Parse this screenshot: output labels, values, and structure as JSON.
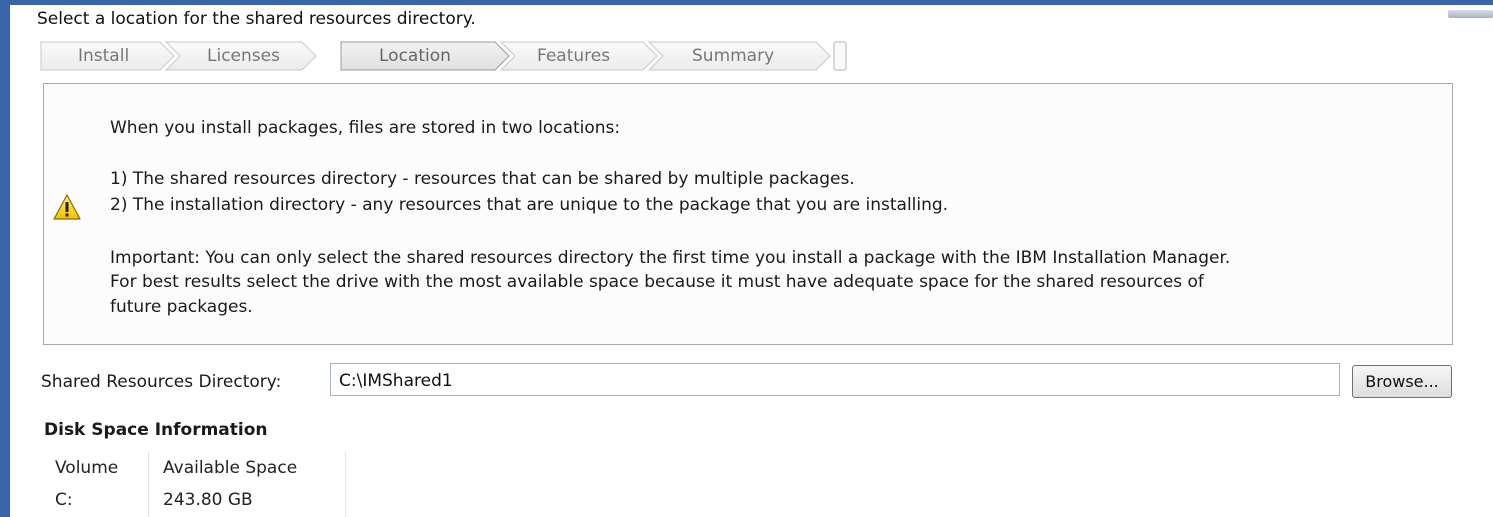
{
  "header": {
    "title": "Select a location for the shared resources directory."
  },
  "steps": [
    {
      "label": "Install",
      "active": false
    },
    {
      "label": "Licenses",
      "active": false
    },
    {
      "label": "Location",
      "active": true
    },
    {
      "label": "Features",
      "active": false
    },
    {
      "label": "Summary",
      "active": false
    }
  ],
  "message": {
    "icon": "warning-icon",
    "intro": "When you install packages, files are stored in two locations:",
    "item1": "1) The shared resources directory - resources that can be shared by multiple packages.",
    "item2": "2) The installation directory - any resources that are unique to the package that you are installing.",
    "important_line1": "Important: You can only select the shared resources directory the first time you install a package with the IBM Installation Manager.",
    "important_line2": "For best results select the drive with the most available space because it must have adequate space for the shared resources of",
    "important_line3": "future packages."
  },
  "directory": {
    "label": "Shared Resources Directory:",
    "value": "C:\\IMShared1",
    "browse_label": "Browse..."
  },
  "disk": {
    "title": "Disk Space Information",
    "columns": [
      "Volume",
      "Available Space"
    ],
    "rows": [
      {
        "volume": "C:",
        "available": "243.80 GB"
      }
    ]
  },
  "colors": {
    "frame": "#3a64a8",
    "warning_yellow": "#f5d000"
  }
}
